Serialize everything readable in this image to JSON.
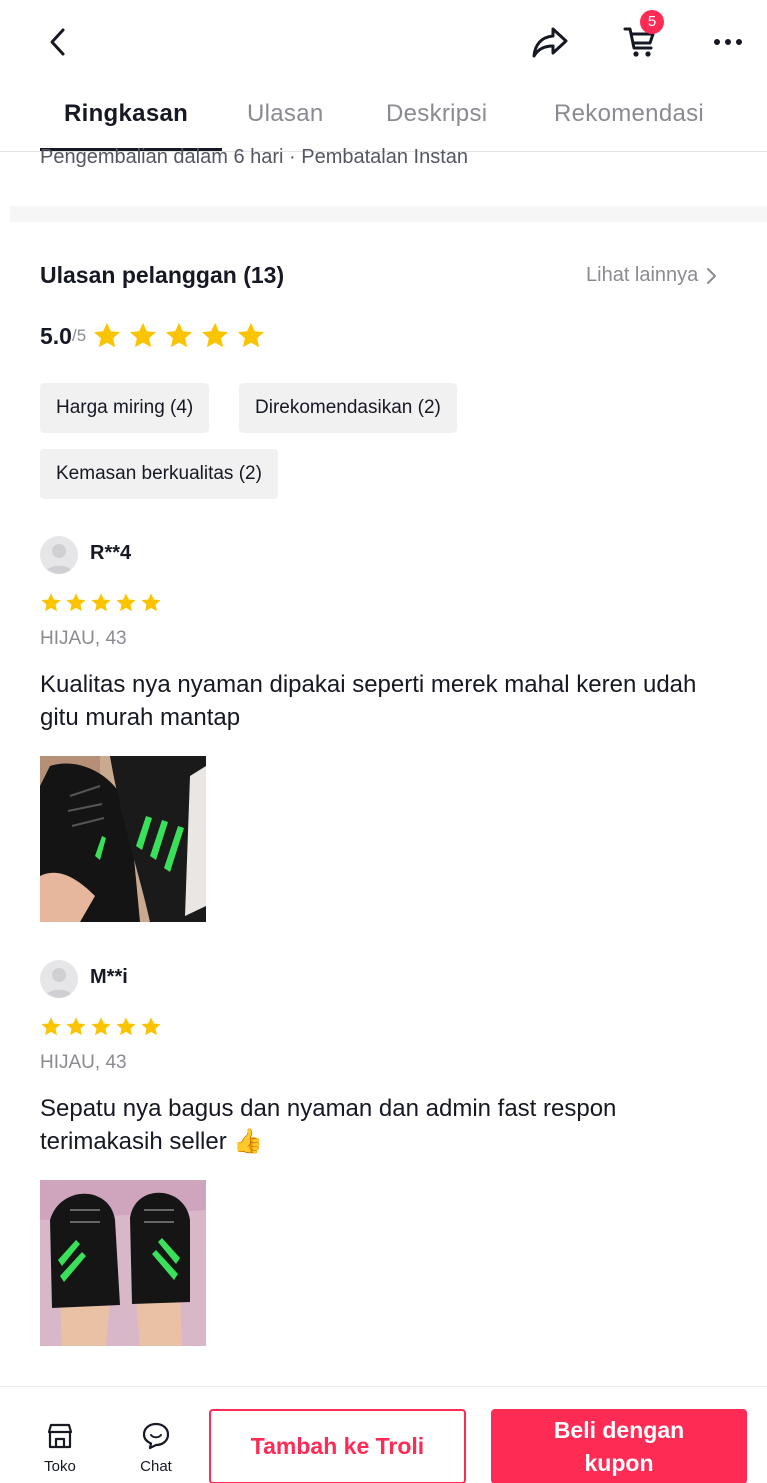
{
  "header": {
    "cart_count": "5"
  },
  "tabs": [
    {
      "label": "Ringkasan"
    },
    {
      "label": "Ulasan"
    },
    {
      "label": "Deskripsi"
    },
    {
      "label": "Rekomendasi"
    }
  ],
  "policy_text": "Pengembalian dalam 6 hari · Pembatalan Instan",
  "reviews_section": {
    "title": "Ulasan pelanggan (13)",
    "see_more": "Lihat lainnya",
    "rating_value": "5.0",
    "rating_max": "/5",
    "stars": 5,
    "tags": [
      {
        "label": "Harga miring (4)"
      },
      {
        "label": "Direkomendasikan (2)"
      },
      {
        "label": "Kemasan berkualitas (2)"
      }
    ]
  },
  "reviews": [
    {
      "username": "R**4",
      "stars": 5,
      "variant": "HIJAU, 43",
      "text": "Kualitas nya nyaman dipakai seperti merek mahal keren udah gitu murah mantap"
    },
    {
      "username": "M**i",
      "stars": 5,
      "variant": "HIJAU, 43",
      "text": "Sepatu nya bagus dan nyaman dan admin fast respon terimakasih seller 👍"
    }
  ],
  "bottom_bar": {
    "shop_label": "Toko",
    "chat_label": "Chat",
    "add_to_cart": "Tambah ke Troli",
    "buy_line1": "Beli dengan",
    "buy_line2": "kupon"
  },
  "colors": {
    "accent": "#fe2c55",
    "star": "#fbc400",
    "text": "#161823",
    "muted": "#8a8b91"
  }
}
